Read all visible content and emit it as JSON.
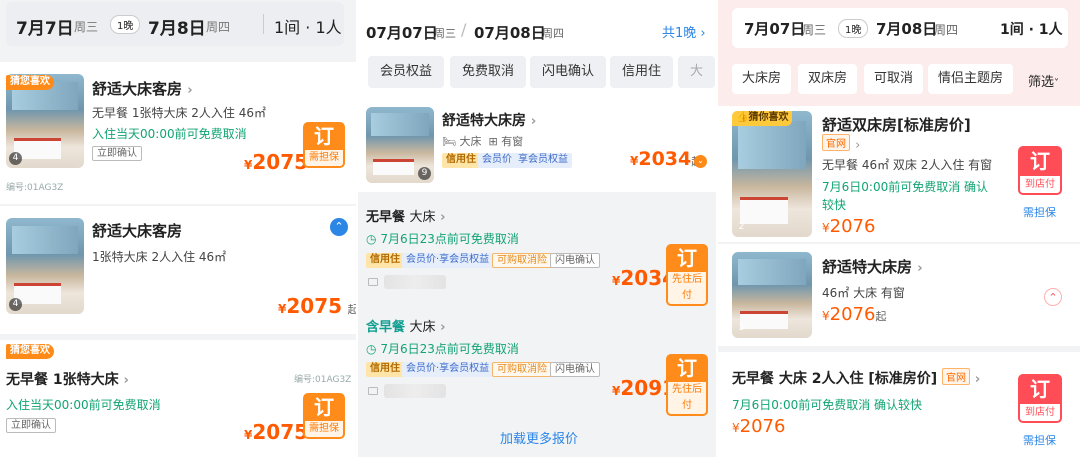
{
  "panel1": {
    "header": {
      "checkin": "7月7日",
      "checkin_wd": "周三",
      "nights": "1晚",
      "checkout": "7月8日",
      "checkout_wd": "周四",
      "rooms_guests": "1间 · 1人"
    },
    "room1": {
      "badge": "猜您喜欢",
      "title": "舒适大床客房",
      "desc": "无早餐  1张特大床  2人入住  46㎡",
      "cancel": "入住当天00:00前可免费取消",
      "confirm": "立即确认",
      "photo_count": "4",
      "currency": "¥",
      "price": "2075",
      "book": "订",
      "book_sub": "需担保",
      "code": "编号:01AG3Z"
    },
    "room2": {
      "title": "舒适大床客房",
      "desc": "1张特大床  2人入住  46㎡",
      "photo_count": "4",
      "currency": "¥",
      "price": "2075",
      "qi": "起"
    },
    "rate": {
      "badge": "猜您喜欢",
      "title": "无早餐  1张特大床",
      "code": "编号:01AG3Z",
      "cancel": "入住当天00:00前可免费取消",
      "confirm": "立即确认",
      "currency": "¥",
      "price": "2075",
      "book": "订",
      "book_sub": "需担保"
    }
  },
  "panel2": {
    "header": {
      "checkin": "07月07日",
      "checkin_wd": "周三",
      "checkout": "07月08日",
      "checkout_wd": "周四",
      "nights": "共1晚"
    },
    "filters": [
      "会员权益",
      "免费取消",
      "闪电确认",
      "信用住",
      "大"
    ],
    "room": {
      "title": "舒适特大床房",
      "bed": "大床",
      "window": "有窗",
      "photo_count": "9",
      "tags": [
        "信用住",
        "会员价",
        "享会员权益"
      ],
      "currency": "¥",
      "price": "2034",
      "qi": "起"
    },
    "rate1": {
      "title": "无早餐",
      "bed": "大床",
      "cancel": "7月6日23点前可免费取消",
      "tags": [
        "信用住",
        "会员价·享会员权益",
        "可购取消险",
        "闪电确认"
      ],
      "currency": "¥",
      "price": "2034",
      "book": "订",
      "book_sub": "先住后付"
    },
    "rate2": {
      "title": "含早餐",
      "bed": "大床",
      "cancel": "7月6日23点前可免费取消",
      "tags": [
        "信用住",
        "会员价·享会员权益",
        "可购取消险",
        "闪电确认"
      ],
      "currency": "¥",
      "price": "2091",
      "book": "订",
      "book_sub": "先住后付"
    },
    "load_more": "加载更多报价"
  },
  "panel3": {
    "header": {
      "checkin": "7月07日",
      "checkin_wd": "周三",
      "nights": "1晚",
      "checkout": "7月08日",
      "checkout_wd": "周四",
      "rooms_guests": "1间 · 1人"
    },
    "filters": [
      "大床房",
      "双床房",
      "可取消",
      "情侣主题房",
      "筛选"
    ],
    "room1": {
      "badge": "猜你喜欢",
      "title": "舒适双床房[标准房价]",
      "official": "官网",
      "desc": "无早餐  46㎡  双床  2人入住  有窗",
      "cancel": "7月6日0:00前可免费取消  确认",
      "cancel2": "较快",
      "photo_count": "2",
      "currency": "¥",
      "price": "2076",
      "book": "订",
      "book_sub": "到店付",
      "guarantee": "需担保"
    },
    "room2": {
      "title": "舒适特大床房",
      "desc": "46㎡  大床  有窗",
      "photo_count": "3",
      "currency": "¥",
      "price": "2076",
      "qi": "起"
    },
    "rate": {
      "title": "无早餐  大床  2人入住  [标准房价]",
      "official": "官网",
      "cancel": "7月6日0:00前可免费取消  确认较快",
      "currency": "¥",
      "price": "2076",
      "book": "订",
      "book_sub": "到店付",
      "guarantee": "需担保"
    }
  },
  "colors": {
    "orange": "#ff8c1a",
    "price": "#ff5a00",
    "green": "#12a472",
    "red_button": "#ff4d57",
    "link_blue": "#2b86e6"
  }
}
